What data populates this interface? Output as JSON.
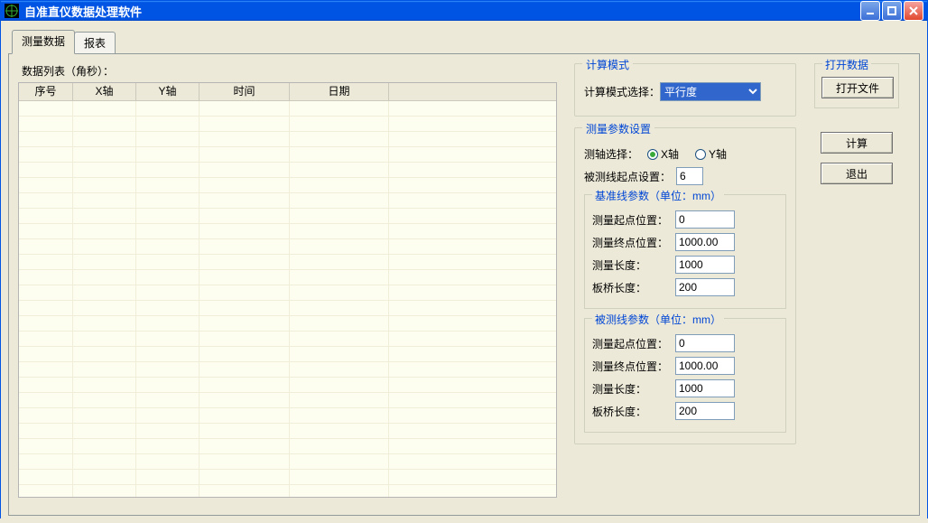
{
  "window": {
    "title": "自准直仪数据处理软件"
  },
  "tabs": {
    "measure": "测量数据",
    "report": "报表"
  },
  "list": {
    "label": "数据列表（角秒）：",
    "columns": {
      "no": "序号",
      "x": "X轴",
      "y": "Y轴",
      "time": "时间",
      "date": "日期"
    }
  },
  "calcMode": {
    "group": "计算模式",
    "label": "计算模式选择：",
    "selected": "平行度"
  },
  "params": {
    "group": "测量参数设置",
    "axisLabel": "测轴选择：",
    "axisX": "X轴",
    "axisY": "Y轴",
    "startLabel": "被测线起点设置：",
    "startValue": "6",
    "baseline": {
      "group": "基准线参数（单位：mm）",
      "startPosLabel": "测量起点位置：",
      "startPos": "0",
      "endPosLabel": "测量终点位置：",
      "endPos": "1000.00",
      "lengthLabel": "测量长度：",
      "length": "1000",
      "bridgeLabel": "板桥长度：",
      "bridge": "200"
    },
    "measured": {
      "group": "被测线参数（单位：mm）",
      "startPosLabel": "测量起点位置：",
      "startPos": "0",
      "endPosLabel": "测量终点位置：",
      "endPos": "1000.00",
      "lengthLabel": "测量长度：",
      "length": "1000",
      "bridgeLabel": "板桥长度：",
      "bridge": "200"
    }
  },
  "openData": {
    "group": "打开数据",
    "openFile": "打开文件"
  },
  "buttons": {
    "calc": "计算",
    "exit": "退出"
  }
}
